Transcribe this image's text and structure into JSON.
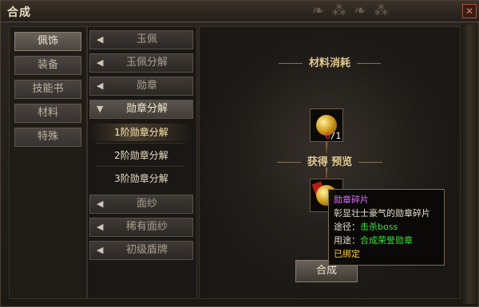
{
  "window": {
    "title": "合成",
    "close_label": "✕"
  },
  "categories": [
    {
      "label": "佩饰",
      "active": true
    },
    {
      "label": "装备",
      "active": false
    },
    {
      "label": "技能书",
      "active": false
    },
    {
      "label": "材料",
      "active": false
    },
    {
      "label": "特殊",
      "active": false
    }
  ],
  "sub_items": [
    {
      "label": "玉佩",
      "open": false
    },
    {
      "label": "玉佩分解",
      "open": false
    },
    {
      "label": "勋章",
      "open": false
    },
    {
      "label": "勋章分解",
      "open": true
    },
    {
      "label": "面纱",
      "open": false
    },
    {
      "label": "稀有面纱",
      "open": false
    },
    {
      "label": "初级盾牌",
      "open": false
    }
  ],
  "children": [
    {
      "label": "1阶勋章分解",
      "selected": true
    },
    {
      "label": "2阶勋章分解",
      "selected": false
    },
    {
      "label": "3阶勋章分解",
      "selected": false
    }
  ],
  "main": {
    "materials_title": "材料消耗",
    "preview_title": "获得 预览",
    "material_count_have": "0",
    "material_count_need": "/1",
    "confirm_label": "合成"
  },
  "tooltip": {
    "name": "勋章碎片",
    "desc": "彰显壮士豪气的勋章碎片",
    "source_label": "途径：",
    "source_value": "击杀boss",
    "use_label": "用途：",
    "use_value": "合成荣誉勋章",
    "bound": "已绑定"
  },
  "colors": {
    "item_name": "#e070ff",
    "green_text": "#40e040",
    "bound_text": "#ffd040",
    "insufficient": "#ff3030"
  },
  "icons": [
    "close-icon",
    "arrow-collapsed-icon",
    "arrow-expanded-icon",
    "medal-icon",
    "medal-fragment-icon"
  ]
}
